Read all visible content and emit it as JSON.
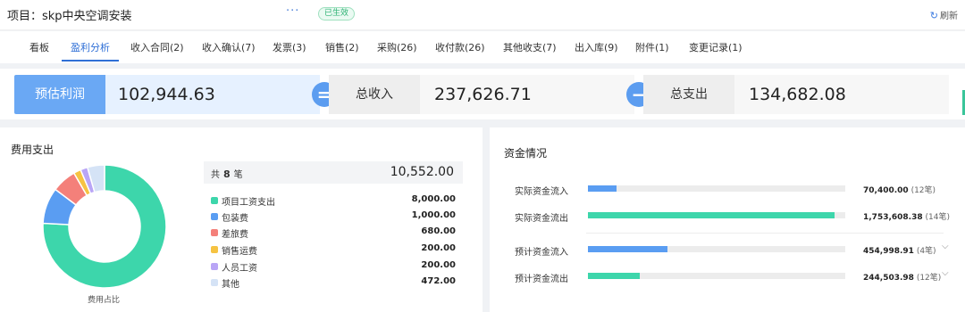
{
  "header": {
    "title": "项目：skp中央空调安装",
    "more": "···",
    "status": "已生效",
    "refresh": "刷新"
  },
  "tabs": [
    {
      "label": "看板"
    },
    {
      "label": "盈利分析",
      "active": true
    },
    {
      "label": "收入合同(2)"
    },
    {
      "label": "收入确认(7)"
    },
    {
      "label": "发票(3)"
    },
    {
      "label": "销售(2)"
    },
    {
      "label": "采购(26)"
    },
    {
      "label": "收付款(26)"
    },
    {
      "label": "其他收支(7)"
    },
    {
      "label": "出入库(9)"
    },
    {
      "label": "附件(1)"
    },
    {
      "label": "变更记录(1)"
    }
  ],
  "summary": {
    "profit_label": "预估利润",
    "profit_value": "102,944.63",
    "income_label": "总收入",
    "income_value": "237,626.71",
    "expense_label": "总支出",
    "expense_value": "134,682.08",
    "equals_sign": "=",
    "minus_sign": "−"
  },
  "expense": {
    "title": "费用支出",
    "caption": "费用占比",
    "total_prefix": "共",
    "total_count": "8",
    "total_suffix": "笔",
    "total_amount": "10,552.00",
    "items": [
      {
        "name": "项目工资支出",
        "value": "8,000.00",
        "amount": 8000,
        "color": "#3dd6ab"
      },
      {
        "name": "包装费",
        "value": "1,000.00",
        "amount": 1000,
        "color": "#5a9df2"
      },
      {
        "name": "差旅费",
        "value": "680.00",
        "amount": 680,
        "color": "#f4807a"
      },
      {
        "name": "销售运费",
        "value": "200.00",
        "amount": 200,
        "color": "#f6c342"
      },
      {
        "name": "人员工资",
        "value": "200.00",
        "amount": 200,
        "color": "#b9a5f6"
      },
      {
        "name": "其他",
        "value": "472.00",
        "amount": 472,
        "color": "#d5e3f6"
      }
    ]
  },
  "funds": {
    "title": "资金情况",
    "rows": [
      {
        "label": "实际资金流入",
        "amount": "70,400.00",
        "count": "(12笔)",
        "fill": 0.11,
        "color": "#5a9df2",
        "expand": false
      },
      {
        "label": "实际资金流出",
        "amount": "1,753,608.38",
        "count": "(14笔)",
        "fill": 0.96,
        "color": "#3dd6ab",
        "expand": false
      },
      {
        "label": "预计资金流入",
        "amount": "454,998.91",
        "count": "(4笔)",
        "fill": 0.31,
        "color": "#5a9df2",
        "expand": true
      },
      {
        "label": "预计资金流出",
        "amount": "244,503.98",
        "count": "(12笔)",
        "fill": 0.2,
        "color": "#3dd6ab",
        "expand": true
      }
    ]
  }
}
